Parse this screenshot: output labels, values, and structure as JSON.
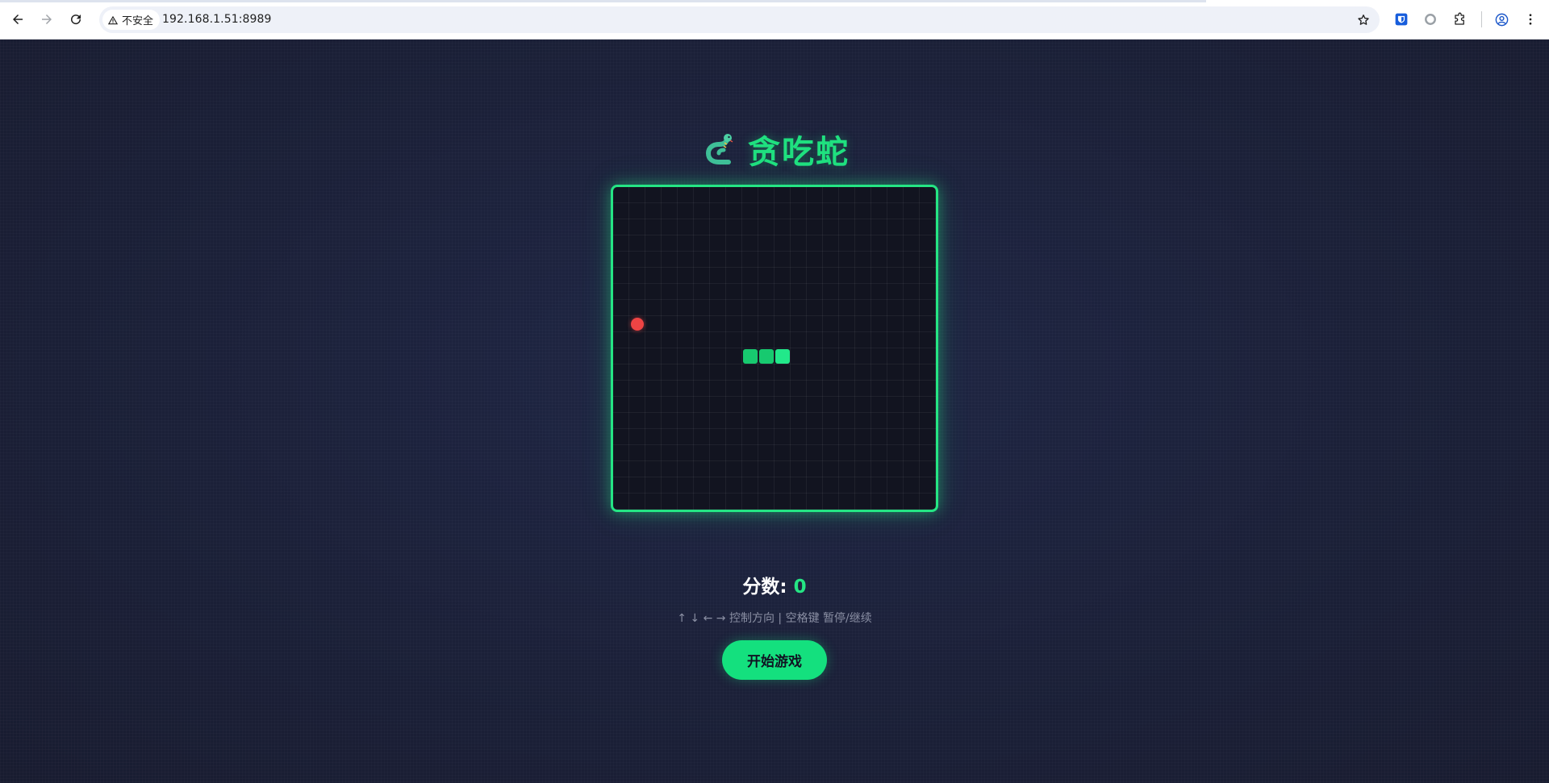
{
  "browser": {
    "security_label": "不安全",
    "url": "192.168.1.51:8989"
  },
  "game": {
    "title": "贪吃蛇",
    "score_label": "分数: ",
    "score_value": "0",
    "hint": "↑ ↓ ← → 控制方向 | 空格键 暂停/继续",
    "start_label": "开始游戏",
    "colors": {
      "accent": "#25e584",
      "snake_head": "#22e88a",
      "snake_body": "#17c96f",
      "food": "#ef4444"
    },
    "grid": {
      "columns": 20,
      "rows": 20
    },
    "snake": [
      {
        "col": 10,
        "row": 10
      },
      {
        "col": 9,
        "row": 10
      },
      {
        "col": 8,
        "row": 10
      }
    ],
    "food": {
      "col": 1,
      "row": 8
    }
  }
}
